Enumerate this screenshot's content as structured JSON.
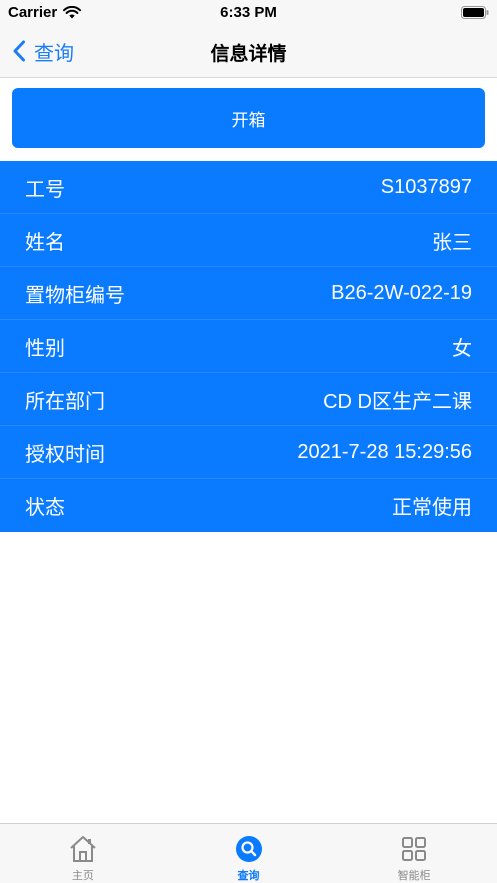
{
  "status_bar": {
    "carrier": "Carrier",
    "time": "6:33 PM"
  },
  "nav": {
    "back_label": "查询",
    "title": "信息详情"
  },
  "open_button_label": "开箱",
  "info_rows": [
    {
      "label": "工号",
      "value": "S1037897"
    },
    {
      "label": "姓名",
      "value": "张三"
    },
    {
      "label": "置物柜编号",
      "value": "B26-2W-022-19"
    },
    {
      "label": "性别",
      "value": "女"
    },
    {
      "label": "所在部门",
      "value": "CD D区生产二课"
    },
    {
      "label": "授权时间",
      "value": "2021-7-28 15:29:56"
    },
    {
      "label": "状态",
      "value": "正常使用"
    }
  ],
  "tabs": [
    {
      "label": "主页",
      "icon": "home-icon",
      "active": false
    },
    {
      "label": "查询",
      "icon": "search-icon",
      "active": true
    },
    {
      "label": "智能柜",
      "icon": "grid-icon",
      "active": false
    }
  ],
  "colors": {
    "accent": "#0a7bff",
    "nav_background": "#f7f7f7",
    "inactive_tab": "#8a8a8a"
  }
}
